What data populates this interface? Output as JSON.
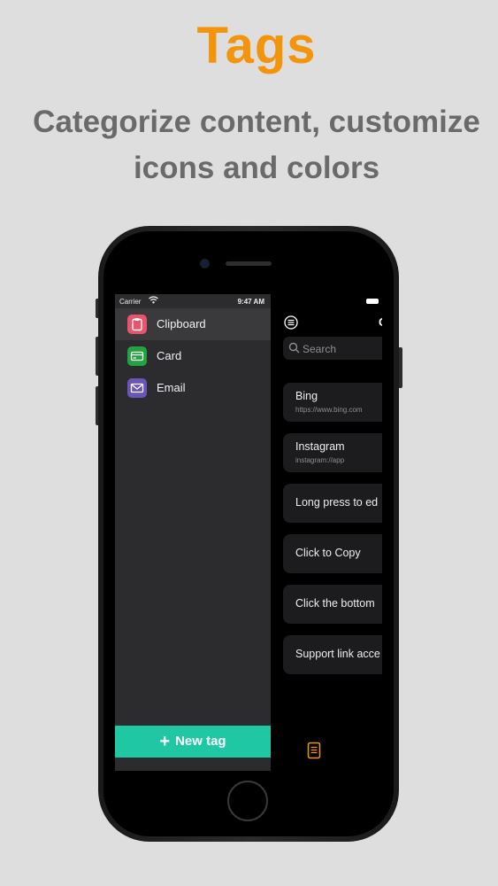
{
  "hero": {
    "title": "Tags",
    "subtitle_line1": "Categorize content, customize",
    "subtitle_line2": "icons and colors"
  },
  "status_bar": {
    "carrier": "Carrier",
    "time": "9:47 AM"
  },
  "drawer": {
    "tags": [
      {
        "label": "Clipboard",
        "icon": "clipboard-icon",
        "color": "#e8546b",
        "active": true
      },
      {
        "label": "Card",
        "icon": "card-icon",
        "color": "#23a33f",
        "active": false
      },
      {
        "label": "Email",
        "icon": "envelope-icon",
        "color": "#6a55b9",
        "active": false
      }
    ],
    "new_tag_label": "New tag",
    "new_tag_color": "#1fc7a3"
  },
  "main": {
    "title_partial": "C",
    "search_placeholder": "Search",
    "items": [
      {
        "title": "Bing",
        "subtitle": "https://www.bing.com"
      },
      {
        "title": "Instagram",
        "subtitle": "instagram://app"
      },
      {
        "title": "Long press to ed",
        "subtitle": ""
      },
      {
        "title": "Click to Copy",
        "subtitle": ""
      },
      {
        "title": "Click the bottom",
        "subtitle": ""
      },
      {
        "title": "Support link acce",
        "subtitle": ""
      }
    ],
    "accent_color": "#f2950c"
  }
}
